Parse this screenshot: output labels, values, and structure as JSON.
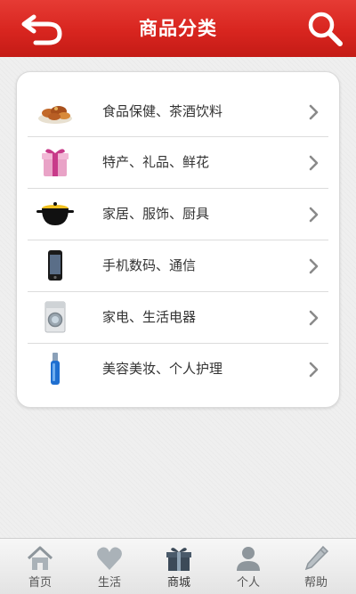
{
  "header": {
    "title": "商品分类",
    "back_icon": "back-arrow-icon",
    "search_icon": "search-icon"
  },
  "categories": [
    {
      "label": "食品保健、茶酒饮料",
      "icon": "food-icon"
    },
    {
      "label": "特产、礼品、鲜花",
      "icon": "gift-box-icon"
    },
    {
      "label": "家居、服饰、厨具",
      "icon": "cooking-pot-icon"
    },
    {
      "label": "手机数码、通信",
      "icon": "mobile-phone-icon"
    },
    {
      "label": "家电、生活电器",
      "icon": "washing-machine-icon"
    },
    {
      "label": "美容美妆、个人护理",
      "icon": "cosmetics-bottle-icon"
    }
  ],
  "tabbar": {
    "tabs": [
      {
        "label": "首页",
        "icon": "home-icon"
      },
      {
        "label": "生活",
        "icon": "heart-icon"
      },
      {
        "label": "商城",
        "icon": "gift-icon",
        "active": true
      },
      {
        "label": "个人",
        "icon": "person-icon"
      },
      {
        "label": "帮助",
        "icon": "pencil-icon"
      }
    ]
  },
  "colors": {
    "header_red": "#d8251f",
    "background": "#efefef",
    "card": "#ffffff",
    "text": "#333333"
  }
}
